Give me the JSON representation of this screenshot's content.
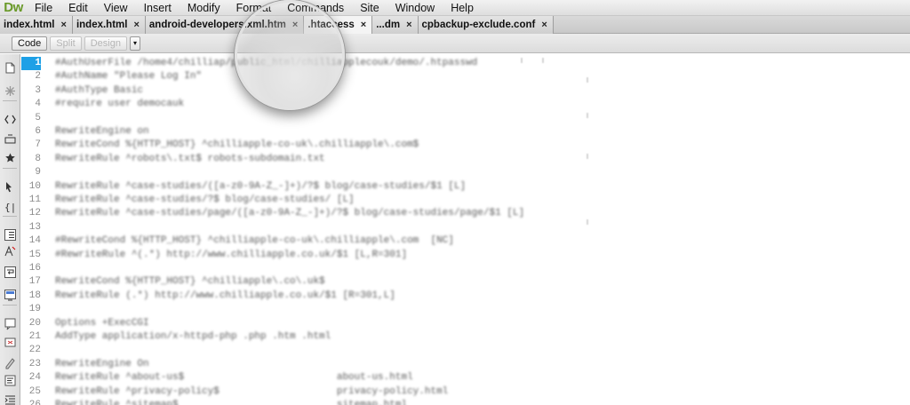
{
  "app": {
    "logo": "Dw"
  },
  "menu": [
    "File",
    "Edit",
    "View",
    "Insert",
    "Modify",
    "Format",
    "Commands",
    "Site",
    "Window",
    "Help"
  ],
  "tabs": [
    {
      "label": "index.html",
      "close": "×"
    },
    {
      "label": "index.html",
      "close": "×"
    },
    {
      "label": "android-developers.xml.htm",
      "close": "×"
    },
    {
      "label": ".htaccess",
      "close": "×",
      "active": true
    },
    {
      "label": "...dm",
      "close": "×"
    },
    {
      "label": "cpbackup-exclude.conf",
      "close": "×"
    }
  ],
  "toolbar": {
    "code": "Code",
    "split": "Split",
    "design": "Design",
    "dropdown": "▾"
  },
  "editor": {
    "current_line": 1,
    "lines": [
      "#AuthUserFile /home4/chilliap/public_html/chilliapplecouk/demo/.htpasswd",
      "#AuthName \"Please Log In\"",
      "#AuthType Basic",
      "#require user democauk",
      "",
      "RewriteEngine on",
      "RewriteCond %{HTTP_HOST} ^chilliapple-co-uk\\.chilliapple\\.com$",
      "RewriteRule ^robots\\.txt$ robots-subdomain.txt",
      "",
      "RewriteRule ^case-studies/([a-z0-9A-Z_-]+)/?$ blog/case-studies/$1 [L]",
      "RewriteRule ^case-studies/?$ blog/case-studies/ [L]",
      "RewriteRule ^case-studies/page/([a-z0-9A-Z_-]+)/?$ blog/case-studies/page/$1 [L]",
      "",
      "#RewriteCond %{HTTP_HOST} ^chilliapple-co-uk\\.chilliapple\\.com  [NC]",
      "#RewriteRule ^(.*) http://www.chilliapple.co.uk/$1 [L,R=301]",
      "",
      "RewriteCond %{HTTP_HOST} ^chilliapple\\.co\\.uk$",
      "RewriteRule (.*) http://www.chilliapple.co.uk/$1 [R=301,L]",
      "",
      "Options +ExecCGI",
      "AddType application/x-httpd-php .php .htm .html",
      "",
      "RewriteEngine On",
      "RewriteRule ^about-us$                          about-us.html",
      "RewriteRule ^privacy-policy$                    privacy-policy.html",
      "RewriteRule ^sitemap$                           sitemap.html"
    ]
  },
  "left_toolbar_icons": [
    "open-documents-icon",
    "show-code-navigator-icon",
    "collapse-full-tag-icon",
    "collapse-selection-icon",
    "expand-all-icon",
    "select-parent-tag-icon",
    "balance-braces-icon",
    "line-numbers-icon",
    "highlight-invalid-code-icon",
    "word-wrap-icon",
    "syntax-coloring-icon",
    "apply-comment-icon",
    "remove-comment-icon",
    "wrap-tag-icon",
    "recent-snippets-icon",
    "indent-code-icon"
  ]
}
